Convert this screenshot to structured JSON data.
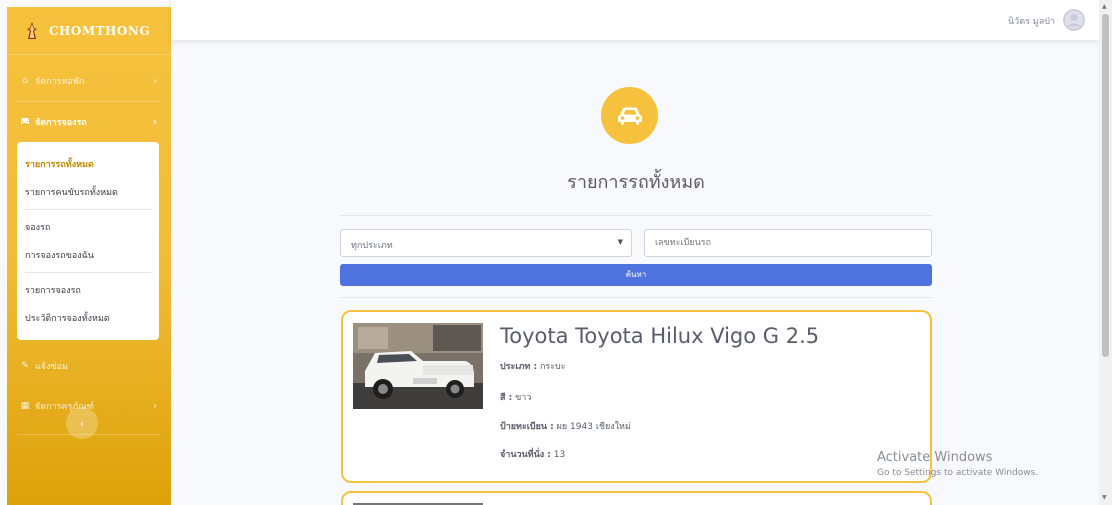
{
  "sidebar": {
    "brand": "CHOMTHONG",
    "items": [
      {
        "label": "จัดการหอพัก",
        "icon": "home-icon"
      },
      {
        "label": "จัดการจองรถ",
        "icon": "car-icon"
      },
      {
        "label": "แจ้งซ่อม",
        "icon": "wrench-icon"
      },
      {
        "label": "จัดการครุภัณฑ์",
        "icon": "table-icon"
      }
    ],
    "submenu": [
      "รายการรถทั้งหมด",
      "รายการคนขับรถทั้งหมด",
      "จองรถ",
      "การจองรถของฉัน",
      "รายการจองรถ",
      "ประวัติการจองทั้งหมด"
    ],
    "toggle": "‹"
  },
  "topbar": {
    "user_name": "นิวัตร มูลป่า"
  },
  "main": {
    "title": "รายการรถทั้งหมด",
    "filter": {
      "select_value": "ทุกประเภท",
      "plate_placeholder": "เลขทะเบียนรถ",
      "search_label": "ค้นหา"
    },
    "cars": [
      {
        "name": "Toyota Toyota Hilux Vigo G 2.5",
        "type_label": "ประเภท :",
        "type": "กระบะ",
        "color_label": "สี :",
        "color": "ขาว",
        "plate_label": "ป้ายทะเบียน :",
        "plate": "ผย 1943 เชียงใหม่",
        "seats_label": "จำนวนที่นั่ง :",
        "seats": "13"
      }
    ]
  },
  "watermark": {
    "line1": "Activate Windows",
    "line2": "Go to Settings to activate Windows."
  },
  "colors": {
    "sidebar": "#f6c23e",
    "primary": "#4e73df",
    "card_border": "#f6c23e"
  }
}
